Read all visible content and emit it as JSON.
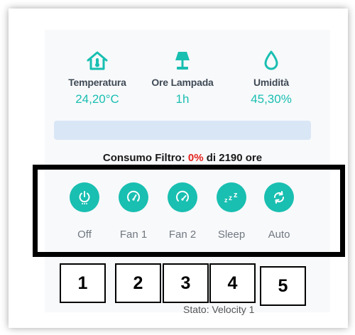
{
  "metrics": {
    "temperature": {
      "icon": "home-thermometer-icon",
      "label": "Temperatura",
      "value": "24,20°C"
    },
    "lamp_hours": {
      "icon": "lamp-icon",
      "label": "Ore Lampada",
      "value": "1h"
    },
    "humidity": {
      "icon": "water-drop-icon",
      "label": "Umidità",
      "value": "45,30%"
    }
  },
  "filter": {
    "progress_percent": 0,
    "prefix": "Consumo Filtro: ",
    "percent_text": "0%",
    "suffix": " di 2190 ore"
  },
  "modes": [
    {
      "icon": "power-icon",
      "label": "Off"
    },
    {
      "icon": "fan-speed-icon",
      "label": "Fan 1"
    },
    {
      "icon": "fan-speed-icon",
      "label": "Fan 2"
    },
    {
      "icon": "sleep-zzz-icon",
      "label": "Sleep"
    },
    {
      "icon": "auto-cycle-icon",
      "label": "Auto"
    }
  ],
  "status": "Stato: Velocity 1",
  "annotations": [
    "1",
    "2",
    "3",
    "4",
    "5"
  ],
  "colors": {
    "accent": "#19bfb1",
    "highlight": "#e5231d",
    "progress_track": "#d9e6f6"
  }
}
